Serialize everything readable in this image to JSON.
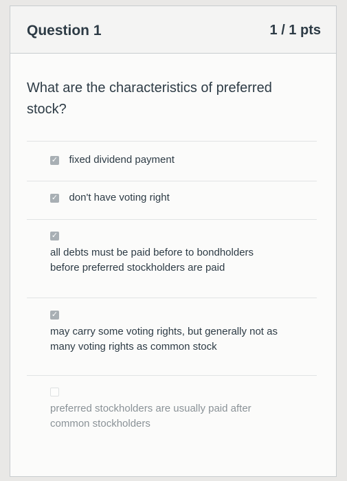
{
  "question": {
    "title": "Question 1",
    "points": "1 / 1 pts",
    "prompt": "What are the characteristics of preferred stock?"
  },
  "answers": [
    {
      "label": "fixed dividend payment",
      "checked": true
    },
    {
      "label": "don't have voting right",
      "checked": true
    },
    {
      "label": "all debts must be paid before to bondholders before preferred stockholders are paid",
      "checked": true
    },
    {
      "label": "may carry some voting rights, but generally not as many voting rights as common stock",
      "checked": true
    },
    {
      "label": "preferred stockholders are usually paid after common stockholders",
      "checked": false
    }
  ],
  "icons": {
    "checked": "checkmark-icon"
  },
  "colors": {
    "text": "#2d3b45",
    "checkbox": "#a8afb4",
    "border": "#c8cccf"
  }
}
